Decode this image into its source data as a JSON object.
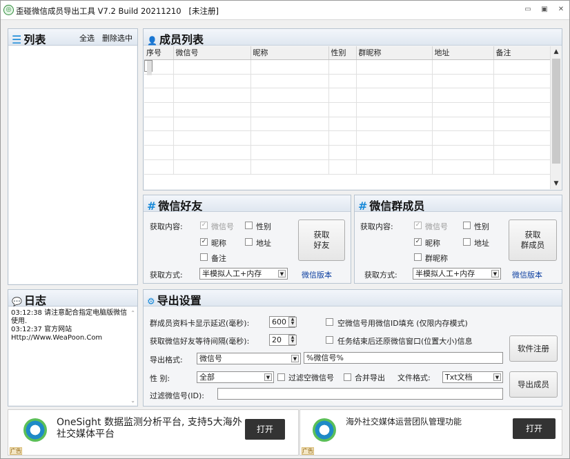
{
  "window": {
    "title": "歪碰微信成员导出工具 V7.2 Build 20211210",
    "status": "[未注册]",
    "icon": "wechat-logo-icon",
    "minimize_glyph": "▭",
    "maximize_glyph": "▣",
    "close_glyph": "✕"
  },
  "list_panel": {
    "title": "列表",
    "icon": "list-icon",
    "icon_glyph": "☰",
    "select_all": "全选",
    "delete_selected": "删除选中"
  },
  "members": {
    "title": "成员列表",
    "icon": "person-icon",
    "icon_glyph": "👤",
    "columns": [
      "序号",
      "微信号",
      "昵称",
      "性别",
      "群昵称",
      "地址",
      "备注"
    ]
  },
  "friends": {
    "title": "微信好友",
    "hash": "#",
    "content_label": "获取内容:",
    "checks": [
      {
        "label": "微信号",
        "checked": true,
        "disabled": true
      },
      {
        "label": "性别",
        "checked": false
      },
      {
        "label": "昵称",
        "checked": true
      },
      {
        "label": "地址",
        "checked": false
      },
      {
        "label": "备注",
        "checked": false
      }
    ],
    "button": "获取\n好友",
    "method_label": "获取方式:",
    "method_value": "半模拟人工+内存",
    "version_link": "微信版本"
  },
  "group": {
    "title": "微信群成员",
    "hash": "#",
    "content_label": "获取内容:",
    "checks": [
      {
        "label": "微信号",
        "checked": true,
        "disabled": true
      },
      {
        "label": "性别",
        "checked": false
      },
      {
        "label": "昵称",
        "checked": true
      },
      {
        "label": "地址",
        "checked": false
      },
      {
        "label": "群昵称",
        "checked": false
      }
    ],
    "button": "获取\n群成员",
    "method_label": "获取方式:",
    "method_value": "半模拟人工+内存",
    "version_link": "微信版本"
  },
  "log": {
    "title": "日志",
    "icon": "speech-bubble-icon",
    "icon_glyph": "💬",
    "lines": [
      "03:12:38   请注意配合指定电脑版微信使用.",
      "03:12:37   官方网站",
      "Http://Www.WeaPoon.Com"
    ]
  },
  "export": {
    "title": "导出设置",
    "icon": "gear-icon",
    "icon_glyph": "⚙",
    "delay_label": "群成员资料卡显示延迟(毫秒):",
    "delay_value": "600",
    "interval_label": "获取微信好友等待间隔(毫秒):",
    "interval_value": "20",
    "empty_id_label": "空微信号用微信ID填充 (仅限内存模式)",
    "restore_label": "任务结束后还原微信窗口(位置大小)信息",
    "format_label": "导出格式:",
    "format_value": "微信号",
    "format_template": "%微信号%",
    "gender_label": "性  别:",
    "gender_value": "全部",
    "filter_empty_label": "过滤空微信号",
    "merge_label": "合并导出",
    "file_format_label": "文件格式:",
    "file_format_value": "Txt文档",
    "filter_id_label": "过滤微信号(ID):",
    "filter_id_value": "",
    "register_button": "软件注册",
    "export_button": "导出成员"
  },
  "ads": [
    {
      "text": "OneSight 数据监测分析平台, 支持5大海外社交媒体平台",
      "button": "打开",
      "tag": "广告"
    },
    {
      "text": "海外社交媒体运营团队管理功能",
      "button": "打开",
      "tag": "广告"
    }
  ]
}
